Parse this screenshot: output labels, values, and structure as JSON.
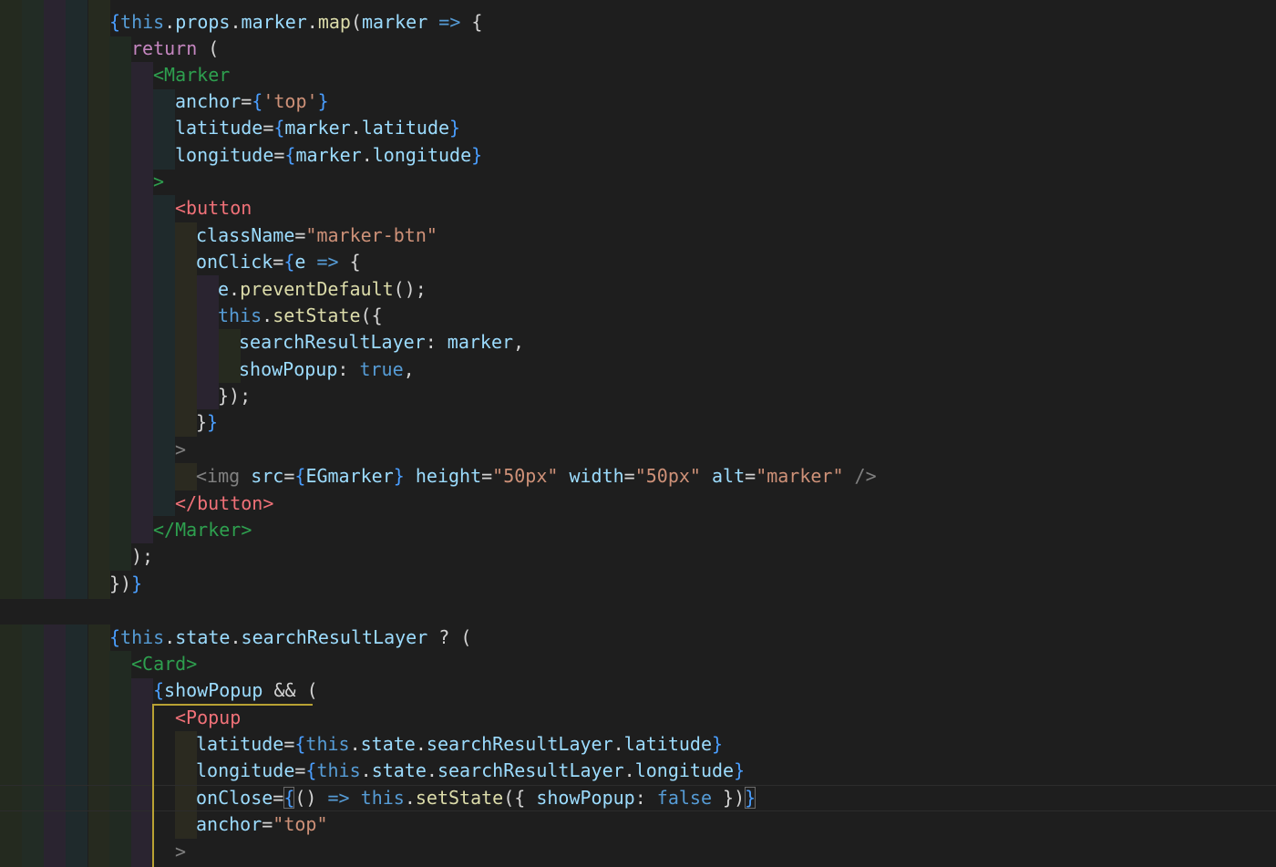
{
  "editor": {
    "lines": [
      {
        "tokens": [
          {
            "t": "{",
            "c": "brace"
          },
          {
            "t": "this",
            "c": "kw"
          },
          {
            "t": ".",
            "c": "plain"
          },
          {
            "t": "props",
            "c": "var"
          },
          {
            "t": ".",
            "c": "plain"
          },
          {
            "t": "marker",
            "c": "var"
          },
          {
            "t": ".",
            "c": "plain"
          },
          {
            "t": "map",
            "c": "fn"
          },
          {
            "t": "(",
            "c": "plain"
          },
          {
            "t": "marker",
            "c": "var"
          },
          {
            "t": " ",
            "c": "plain"
          },
          {
            "t": "=>",
            "c": "kw"
          },
          {
            "t": " {",
            "c": "plain"
          }
        ]
      },
      {
        "tokens": [
          {
            "t": "return",
            "c": "ctl"
          },
          {
            "t": " (",
            "c": "plain"
          }
        ]
      },
      {
        "tokens": [
          {
            "t": "<Marker",
            "c": "tag-green"
          }
        ]
      },
      {
        "tokens": [
          {
            "t": "anchor",
            "c": "var"
          },
          {
            "t": "=",
            "c": "plain"
          },
          {
            "t": "{",
            "c": "brace"
          },
          {
            "t": "'top'",
            "c": "str"
          },
          {
            "t": "}",
            "c": "brace"
          }
        ]
      },
      {
        "tokens": [
          {
            "t": "latitude",
            "c": "var"
          },
          {
            "t": "=",
            "c": "plain"
          },
          {
            "t": "{",
            "c": "brace"
          },
          {
            "t": "marker",
            "c": "var"
          },
          {
            "t": ".",
            "c": "plain"
          },
          {
            "t": "latitude",
            "c": "var"
          },
          {
            "t": "}",
            "c": "brace"
          }
        ]
      },
      {
        "tokens": [
          {
            "t": "longitude",
            "c": "var"
          },
          {
            "t": "=",
            "c": "plain"
          },
          {
            "t": "{",
            "c": "brace"
          },
          {
            "t": "marker",
            "c": "var"
          },
          {
            "t": ".",
            "c": "plain"
          },
          {
            "t": "longitude",
            "c": "var"
          },
          {
            "t": "}",
            "c": "brace"
          }
        ]
      },
      {
        "tokens": [
          {
            "t": ">",
            "c": "tag-green"
          }
        ]
      },
      {
        "tokens": [
          {
            "t": "<button",
            "c": "tag-red"
          }
        ]
      },
      {
        "tokens": [
          {
            "t": "className",
            "c": "var"
          },
          {
            "t": "=",
            "c": "plain"
          },
          {
            "t": "\"marker-btn\"",
            "c": "str"
          }
        ]
      },
      {
        "tokens": [
          {
            "t": "onClick",
            "c": "var"
          },
          {
            "t": "=",
            "c": "plain"
          },
          {
            "t": "{",
            "c": "brace"
          },
          {
            "t": "e",
            "c": "var"
          },
          {
            "t": " ",
            "c": "plain"
          },
          {
            "t": "=>",
            "c": "kw"
          },
          {
            "t": " {",
            "c": "plain"
          }
        ]
      },
      {
        "tokens": [
          {
            "t": "e",
            "c": "var"
          },
          {
            "t": ".",
            "c": "plain"
          },
          {
            "t": "preventDefault",
            "c": "fn"
          },
          {
            "t": "();",
            "c": "plain"
          }
        ]
      },
      {
        "tokens": [
          {
            "t": "this",
            "c": "kw"
          },
          {
            "t": ".",
            "c": "plain"
          },
          {
            "t": "setState",
            "c": "fn"
          },
          {
            "t": "({",
            "c": "plain"
          }
        ]
      },
      {
        "tokens": [
          {
            "t": "searchResultLayer",
            "c": "var"
          },
          {
            "t": ": ",
            "c": "plain"
          },
          {
            "t": "marker",
            "c": "var"
          },
          {
            "t": ",",
            "c": "plain"
          }
        ]
      },
      {
        "tokens": [
          {
            "t": "showPopup",
            "c": "var"
          },
          {
            "t": ": ",
            "c": "plain"
          },
          {
            "t": "true",
            "c": "kw"
          },
          {
            "t": ",",
            "c": "plain"
          }
        ]
      },
      {
        "tokens": [
          {
            "t": "});",
            "c": "plain"
          }
        ]
      },
      {
        "tokens": [
          {
            "t": "}",
            "c": "plain"
          },
          {
            "t": "}",
            "c": "brace"
          }
        ]
      },
      {
        "tokens": [
          {
            "t": ">",
            "c": "punct"
          }
        ]
      },
      {
        "tokens": [
          {
            "t": "<img",
            "c": "punct"
          },
          {
            "t": " ",
            "c": "plain"
          },
          {
            "t": "src",
            "c": "var"
          },
          {
            "t": "=",
            "c": "plain"
          },
          {
            "t": "{",
            "c": "brace"
          },
          {
            "t": "EGmarker",
            "c": "var"
          },
          {
            "t": "}",
            "c": "brace"
          },
          {
            "t": " ",
            "c": "plain"
          },
          {
            "t": "height",
            "c": "var"
          },
          {
            "t": "=",
            "c": "plain"
          },
          {
            "t": "\"50px\"",
            "c": "str"
          },
          {
            "t": " ",
            "c": "plain"
          },
          {
            "t": "width",
            "c": "var"
          },
          {
            "t": "=",
            "c": "plain"
          },
          {
            "t": "\"50px\"",
            "c": "str"
          },
          {
            "t": " ",
            "c": "plain"
          },
          {
            "t": "alt",
            "c": "var"
          },
          {
            "t": "=",
            "c": "plain"
          },
          {
            "t": "\"marker\"",
            "c": "str"
          },
          {
            "t": " />",
            "c": "punct"
          }
        ]
      },
      {
        "tokens": [
          {
            "t": "</button>",
            "c": "tag-red"
          }
        ]
      },
      {
        "tokens": [
          {
            "t": "</Marker>",
            "c": "tag-green"
          }
        ]
      },
      {
        "tokens": [
          {
            "t": ");",
            "c": "plain"
          }
        ]
      },
      {
        "tokens": [
          {
            "t": "})",
            "c": "plain"
          },
          {
            "t": "}",
            "c": "brace"
          }
        ]
      },
      {
        "tokens": []
      },
      {
        "tokens": [
          {
            "t": "{",
            "c": "brace"
          },
          {
            "t": "this",
            "c": "kw"
          },
          {
            "t": ".",
            "c": "plain"
          },
          {
            "t": "state",
            "c": "var"
          },
          {
            "t": ".",
            "c": "plain"
          },
          {
            "t": "searchResultLayer",
            "c": "var"
          },
          {
            "t": " ? (",
            "c": "plain"
          }
        ]
      },
      {
        "tokens": [
          {
            "t": "<Card>",
            "c": "tag-green"
          }
        ]
      },
      {
        "tokens": [
          {
            "t": "{",
            "c": "brace"
          },
          {
            "t": "showPopup",
            "c": "var"
          },
          {
            "t": " && (",
            "c": "plain"
          }
        ]
      },
      {
        "tokens": [
          {
            "t": "<Popup",
            "c": "tag-red"
          }
        ]
      },
      {
        "tokens": [
          {
            "t": "latitude",
            "c": "var"
          },
          {
            "t": "=",
            "c": "plain"
          },
          {
            "t": "{",
            "c": "brace"
          },
          {
            "t": "this",
            "c": "kw"
          },
          {
            "t": ".",
            "c": "plain"
          },
          {
            "t": "state",
            "c": "var"
          },
          {
            "t": ".",
            "c": "plain"
          },
          {
            "t": "searchResultLayer",
            "c": "var"
          },
          {
            "t": ".",
            "c": "plain"
          },
          {
            "t": "latitude",
            "c": "var"
          },
          {
            "t": "}",
            "c": "brace"
          }
        ]
      },
      {
        "tokens": [
          {
            "t": "longitude",
            "c": "var"
          },
          {
            "t": "=",
            "c": "plain"
          },
          {
            "t": "{",
            "c": "brace"
          },
          {
            "t": "this",
            "c": "kw"
          },
          {
            "t": ".",
            "c": "plain"
          },
          {
            "t": "state",
            "c": "var"
          },
          {
            "t": ".",
            "c": "plain"
          },
          {
            "t": "searchResultLayer",
            "c": "var"
          },
          {
            "t": ".",
            "c": "plain"
          },
          {
            "t": "longitude",
            "c": "var"
          },
          {
            "t": "}",
            "c": "brace"
          }
        ]
      },
      {
        "tokens": [
          {
            "t": "onClose",
            "c": "var"
          },
          {
            "t": "=",
            "c": "plain"
          },
          {
            "t": "{",
            "c": "brace"
          },
          {
            "t": "() ",
            "c": "plain"
          },
          {
            "t": "=>",
            "c": "kw"
          },
          {
            "t": " ",
            "c": "plain"
          },
          {
            "t": "this",
            "c": "kw"
          },
          {
            "t": ".",
            "c": "plain"
          },
          {
            "t": "setState",
            "c": "fn"
          },
          {
            "t": "({ ",
            "c": "plain"
          },
          {
            "t": "showPopup",
            "c": "var"
          },
          {
            "t": ": ",
            "c": "plain"
          },
          {
            "t": "false",
            "c": "kw"
          },
          {
            "t": " })",
            "c": "plain"
          },
          {
            "t": "}",
            "c": "brace"
          }
        ]
      },
      {
        "tokens": [
          {
            "t": "anchor",
            "c": "var"
          },
          {
            "t": "=",
            "c": "plain"
          },
          {
            "t": "\"top\"",
            "c": "str"
          }
        ]
      },
      {
        "tokens": [
          {
            "t": ">",
            "c": "punct"
          }
        ]
      }
    ]
  }
}
